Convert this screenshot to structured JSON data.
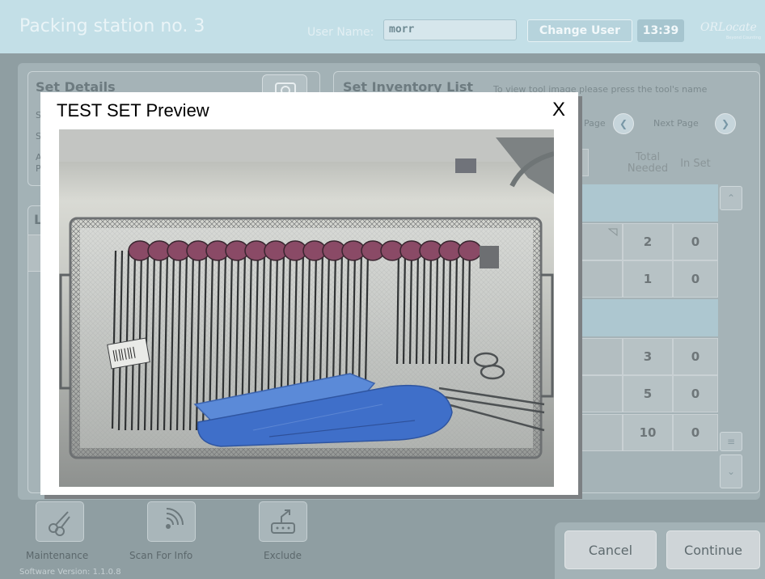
{
  "header": {
    "title": "Packing station no. 3",
    "user_label": "User Name:",
    "user_value": "morr",
    "change_user": "Change User",
    "time": "13:39",
    "logo": "ORLocate",
    "logo_tagline": "Beyond Counting"
  },
  "set_details": {
    "title": "Set Details",
    "peek_lines": [
      "S",
      "S",
      "A",
      "P"
    ],
    "lower_panel_initial": "L"
  },
  "inventory": {
    "title": "Set Inventory List",
    "hint": "To view tool image please press the tool's name",
    "prev_page_fragment": "Page",
    "next_page": "Next Page",
    "col_total": "Total Needed",
    "col_in_set": "In Set",
    "rows": [
      {
        "total": "2",
        "in_set": "0"
      },
      {
        "total": "1",
        "in_set": "0"
      },
      {
        "total": "3",
        "in_set": "0"
      },
      {
        "total": "5",
        "in_set": "0"
      },
      {
        "total": "10",
        "in_set": "0"
      }
    ]
  },
  "toolbar": {
    "maintenance": "Maintenance",
    "scan": "Scan For Info",
    "exclude": "Exclude"
  },
  "actions": {
    "cancel": "Cancel",
    "continue": "Continue"
  },
  "version": "Software Version: 1.1.0.8",
  "modal": {
    "title": "TEST SET Preview",
    "close": "X"
  },
  "colors": {
    "header_bg": "#c3dfe7",
    "overlay_bg": "#8f9ea2",
    "modal_bg": "#ffffff",
    "drape_blue": "#3f6fc9",
    "tray_metal": "#9aa0a4"
  },
  "icons": [
    "camera-icon",
    "chevron-left-icon",
    "chevron-right-icon",
    "chevron-up-icon",
    "chevron-down-icon",
    "menu-lines-icon",
    "scissors-icon",
    "wireless-scan-icon",
    "exclude-tray-icon"
  ]
}
